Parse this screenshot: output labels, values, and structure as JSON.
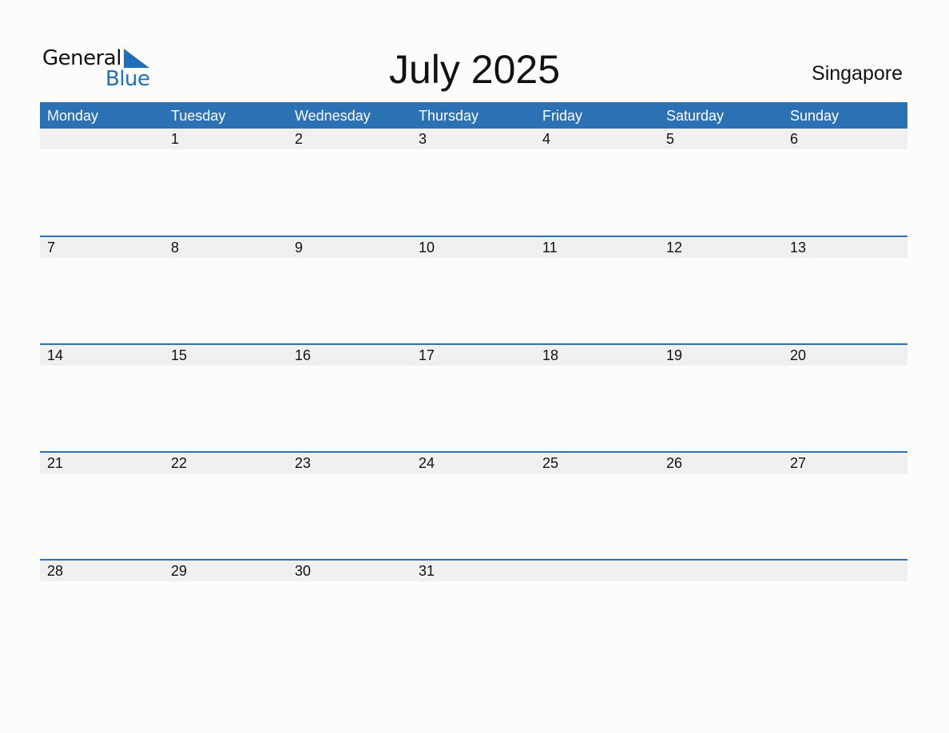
{
  "logo": {
    "line1": "General",
    "line2": "Blue",
    "brand_color": "#1f6fba"
  },
  "title": "July 2025",
  "country": "Singapore",
  "header_color": "#2c71b4",
  "weekdays": [
    "Monday",
    "Tuesday",
    "Wednesday",
    "Thursday",
    "Friday",
    "Saturday",
    "Sunday"
  ],
  "weeks": [
    [
      "",
      "1",
      "2",
      "3",
      "4",
      "5",
      "6"
    ],
    [
      "7",
      "8",
      "9",
      "10",
      "11",
      "12",
      "13"
    ],
    [
      "14",
      "15",
      "16",
      "17",
      "18",
      "19",
      "20"
    ],
    [
      "21",
      "22",
      "23",
      "24",
      "25",
      "26",
      "27"
    ],
    [
      "28",
      "29",
      "30",
      "31",
      "",
      "",
      ""
    ]
  ]
}
